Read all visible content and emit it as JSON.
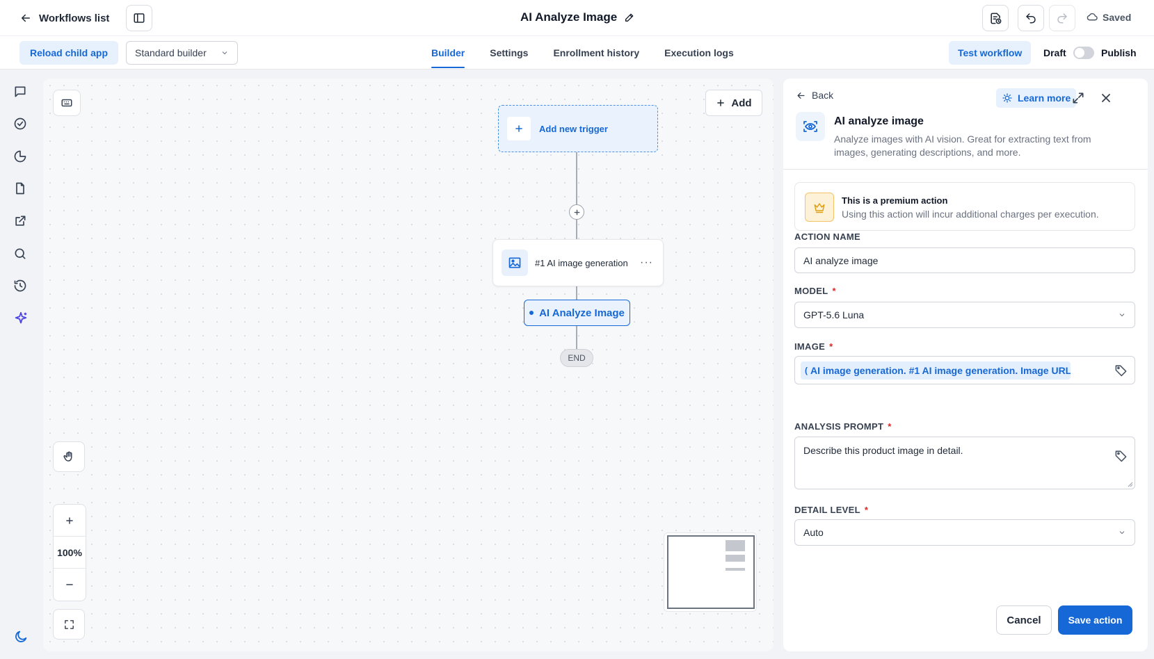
{
  "header": {
    "back_label": "Workflows list",
    "workflow_title": "AI Analyze Image",
    "save_status": "Saved"
  },
  "subbar": {
    "reload_label": "Reload child app",
    "builder_mode": "Standard builder",
    "tabs": [
      {
        "label": "Builder",
        "active": true
      },
      {
        "label": "Settings",
        "active": false
      },
      {
        "label": "Enrollment history",
        "active": false
      },
      {
        "label": "Execution logs",
        "active": false
      }
    ],
    "test_label": "Test workflow",
    "draft_label": "Draft",
    "publish_label": "Publish",
    "publish_enabled": false
  },
  "left_rail": {
    "icons": [
      "chat-icon",
      "check-circle-icon",
      "pie-chart-icon",
      "document-icon",
      "external-link-icon",
      "search-icon",
      "history-icon",
      "sparkle-icon",
      "moon-icon"
    ]
  },
  "canvas": {
    "add_label": "Add",
    "trigger_label": "Add new trigger",
    "node_label": "#1 AI image generation",
    "selected_node_label": "AI Analyze Image",
    "end_label": "END",
    "zoom_level": "100%"
  },
  "panel": {
    "back_label": "Back",
    "learn_more_label": "Learn more",
    "title": "AI analyze image",
    "description": "Analyze images with AI vision. Great for extracting text from images, generating descriptions, and more.",
    "premium_title": "This is a premium action",
    "premium_desc": "Using this action will incur additional charges per execution.",
    "action_name_label": "ACTION NAME",
    "action_name_value": "AI analyze image",
    "model_label": "MODEL",
    "model_value": "GPT-5.6 Luna",
    "image_label": "IMAGE",
    "image_value": "AI image generation. #1 AI image generation. Image URL",
    "prompt_label": "ANALYSIS PROMPT",
    "prompt_value": "Describe this product image in detail.",
    "detail_label": "DETAIL LEVEL",
    "detail_value": "Auto",
    "required_mark": "*",
    "cancel_label": "Cancel",
    "save_label": "Save action"
  },
  "colors": {
    "accent": "#1668d6",
    "accent_soft": "#e6f1fd",
    "required": "#dc2626",
    "premium": "#e0a015"
  }
}
